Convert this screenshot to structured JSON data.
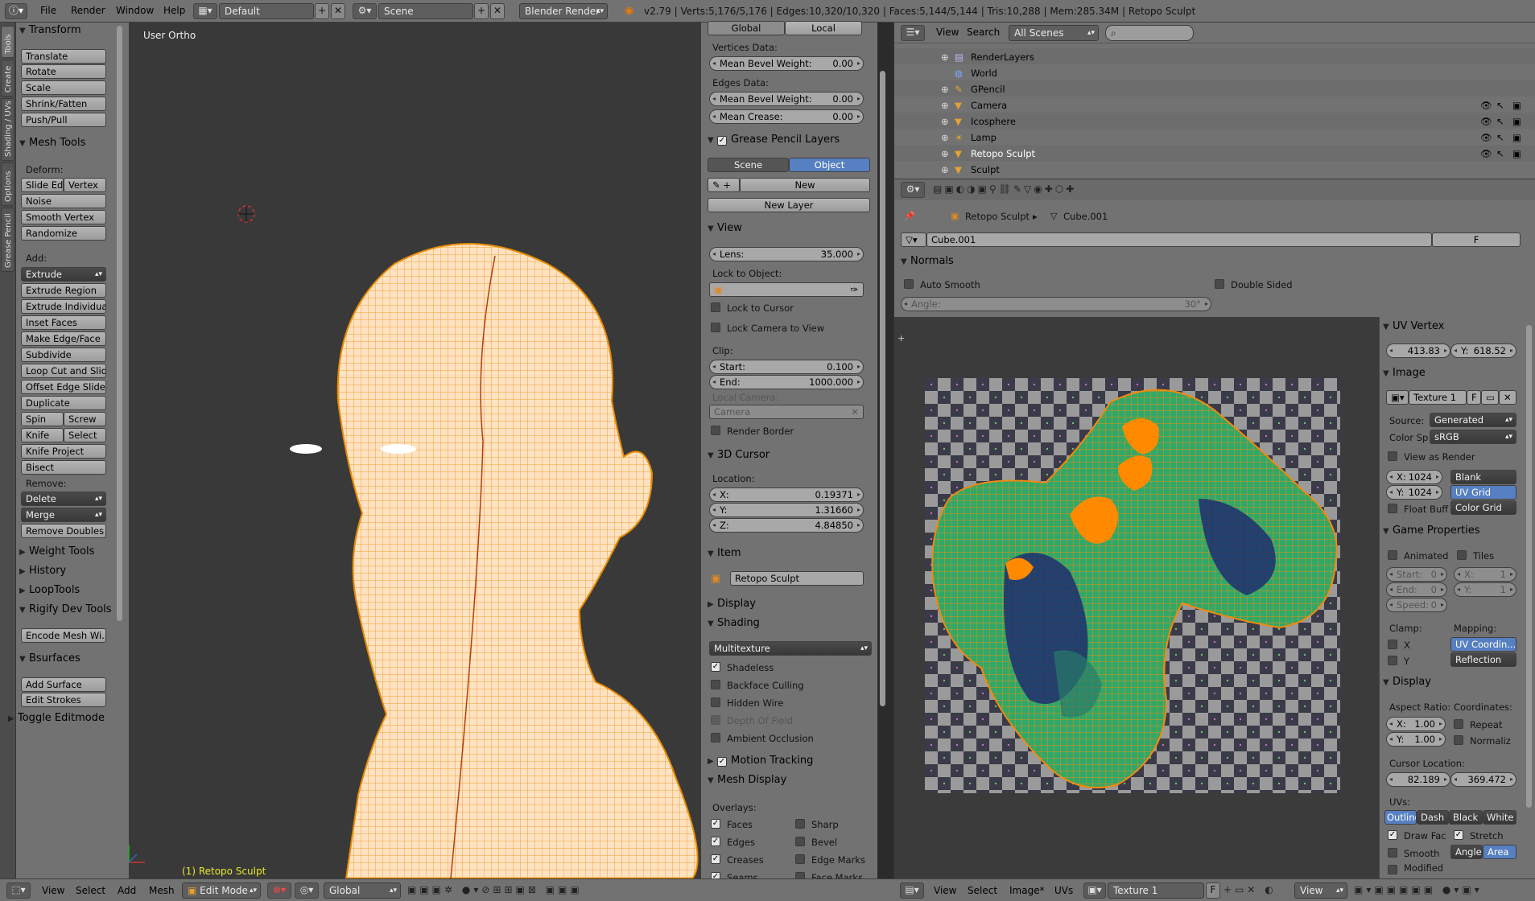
{
  "topbar": {
    "menus": [
      "File",
      "Render",
      "Window",
      "Help"
    ],
    "layout": "Default",
    "scene": "Scene",
    "engine": "Blender Render",
    "stats": "v2.79 | Verts:5,176/5,176 | Edges:10,320/10,320 | Faces:5,144/5,144 | Tris:10,288 | Mem:285.34M | Retopo Sculpt"
  },
  "tabs": [
    "Tools",
    "Create",
    "Shading / UVs",
    "Options",
    "Grease Pencil"
  ],
  "toolshelf": {
    "transform": {
      "title": "Transform",
      "buttons": [
        "Translate",
        "Rotate",
        "Scale",
        "Shrink/Fatten",
        "Push/Pull"
      ]
    },
    "meshtools": {
      "title": "Mesh Tools",
      "deform": "Deform:",
      "slide_edge": "Slide Ed",
      "vertex": "Vertex",
      "noise": "Noise",
      "smooth_vertex": "Smooth Vertex",
      "randomize": "Randomize",
      "add": "Add:",
      "extrude": "Extrude",
      "extrude_region": "Extrude Region",
      "extrude_individual": "Extrude Individual",
      "inset_faces": "Inset Faces",
      "make_edge_face": "Make Edge/Face",
      "subdivide": "Subdivide",
      "loop_cut": "Loop Cut and Slide",
      "offset_edge": "Offset Edge Slide",
      "duplicate": "Duplicate",
      "spin": "Spin",
      "screw": "Screw",
      "knife": "Knife",
      "select": "Select",
      "knife_project": "Knife Project",
      "bisect": "Bisect",
      "remove": "Remove:",
      "delete": "Delete",
      "merge": "Merge",
      "remove_doubles": "Remove Doubles"
    },
    "collapsed": [
      "Weight Tools",
      "History",
      "LoopTools"
    ],
    "rigify": {
      "title": "Rigify Dev Tools",
      "button": "Encode Mesh Wi..."
    },
    "bsurfaces": {
      "title": "Bsurfaces",
      "add_surface": "Add Surface",
      "edit_strokes": "Edit Strokes"
    },
    "toggle": "Toggle Editmode"
  },
  "viewport": {
    "label": "User Ortho",
    "object": "(1) Retopo Sculpt"
  },
  "props": {
    "global": "Global",
    "local": "Local",
    "vertices_data": "Vertices Data:",
    "mean_bevel_weight": "Mean Bevel Weight:",
    "mbw_v": "0.00",
    "edges_data": "Edges Data:",
    "mean_bevel_weight2": "Mean Bevel Weight:",
    "mbw_e": "0.00",
    "mean_crease": "Mean Crease:",
    "mc": "0.00",
    "gp_layers": "Grease Pencil Layers",
    "scene": "Scene",
    "object": "Object",
    "new": "New",
    "new_layer": "New Layer",
    "view": "View",
    "lens": "Lens:",
    "lens_v": "35.000",
    "lock_to_object": "Lock to Object:",
    "lock_to_cursor": "Lock to Cursor",
    "lock_camera": "Lock Camera to View",
    "clip": "Clip:",
    "start": "Start:",
    "start_v": "0.100",
    "end": "End:",
    "end_v": "1000.000",
    "local_camera": "Local Camera:",
    "camera": "Camera",
    "render_border": "Render Border",
    "cursor3d": "3D Cursor",
    "location": "Location:",
    "x": "X:",
    "x_v": "0.19371",
    "y": "Y:",
    "y_v": "1.31660",
    "z": "Z:",
    "z_v": "4.84850",
    "item": "Item",
    "item_name": "Retopo Sculpt",
    "display": "Display",
    "shading": "Shading",
    "multitexture": "Multitexture",
    "shadeless": "Shadeless",
    "backface": "Backface Culling",
    "hidden_wire": "Hidden Wire",
    "dof": "Depth Of Field",
    "ao": "Ambient Occlusion",
    "motion_tracking": "Motion Tracking",
    "mesh_display": "Mesh Display",
    "overlays": "Overlays:",
    "faces": "Faces",
    "sharp": "Sharp",
    "edges": "Edges",
    "bevel": "Bevel",
    "creases": "Creases",
    "edge_marks": "Edge Marks",
    "seams": "Seams",
    "face_marks": "Face Marks"
  },
  "outliner": {
    "view": "View",
    "search": "Search",
    "scenes": "All Scenes",
    "items": [
      "RenderLayers",
      "World",
      "GPencil",
      "Camera",
      "Icosphere",
      "Lamp",
      "Retopo Sculpt",
      "Sculpt"
    ]
  },
  "propsed": {
    "crumb_obj": "Retopo Sculpt",
    "crumb_mesh": "Cube.001",
    "mesh_name": "Cube.001",
    "fake": "F",
    "normals": "Normals",
    "auto_smooth": "Auto Smooth",
    "double_sided": "Double Sided",
    "angle": "Angle:",
    "angle_v": "30°"
  },
  "uvside": {
    "uv_vertex": "UV Vertex",
    "uvx": "413.83",
    "uvy_l": "Y:",
    "uvy": "618.52",
    "image": "Image",
    "texture": "Texture 1",
    "f": "F",
    "source": "Source:",
    "source_v": "Generated",
    "colorsp": "Color Sp",
    "colorsp_v": "sRGB",
    "view_as_render": "View as Render",
    "x": "X:",
    "xv": "1024",
    "y": "Y:",
    "yv": "1024",
    "blank": "Blank",
    "uvgrid": "UV Grid",
    "floatbuf": "Float Buff",
    "colorgrid": "Color Grid",
    "game": "Game Properties",
    "animated": "Animated",
    "tiles": "Tiles",
    "start": "Start:",
    "start_v": "0",
    "end": "End:",
    "end_v": "0",
    "speed": "Speed:",
    "speed_v": "0",
    "gx": "X:",
    "gxv": "1",
    "gy": "Y:",
    "gyv": "1",
    "clamp": "Clamp:",
    "mapping": "Mapping:",
    "cx": "X",
    "cy": "Y",
    "uvcoord": "UV Coordin...",
    "reflection": "Reflection",
    "display": "Display",
    "aspect": "Aspect Ratio:",
    "coords": "Coordinates:",
    "ax": "X:",
    "axv": "1.00",
    "ay": "Y:",
    "ayv": "1.00",
    "repeat": "Repeat",
    "normalize": "Normaliz",
    "cursor_loc": "Cursor Location:",
    "clx": "82.189",
    "cly": "369.472",
    "uvs": "UVs:",
    "outline": "Outline",
    "dash": "Dash",
    "black": "Black",
    "white": "White",
    "drawfac": "Draw Fac",
    "stretch": "Stretch",
    "smooth": "Smooth",
    "angle": "Angle",
    "area": "Area",
    "modified": "Modified"
  },
  "bottom_left": {
    "view": "View",
    "select": "Select",
    "add": "Add",
    "mesh": "Mesh",
    "mode": "Edit Mode",
    "orient": "Global"
  },
  "bottom_right": {
    "view": "View",
    "select": "Select",
    "image": "Image*",
    "uvs": "UVs",
    "texture": "Texture 1",
    "f": "F",
    "view2": "View"
  }
}
